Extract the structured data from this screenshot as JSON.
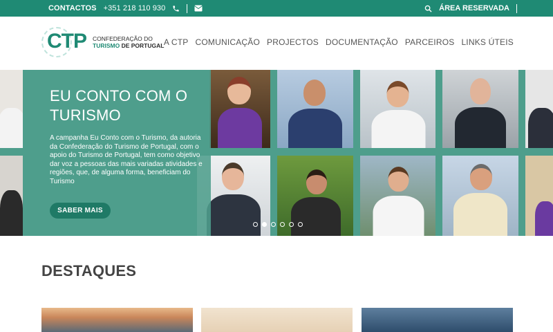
{
  "topbar": {
    "contact_label": "CONTACTOS",
    "phone": "+351 218 110 930",
    "icons": [
      "phone-icon",
      "mail-icon",
      "search-icon"
    ],
    "reserved_label": "ÁREA RESERVADA"
  },
  "logo": {
    "acronym": "CTP",
    "line1": "CONFEDERAÇÃO DO",
    "line2a": "TURISMO",
    "line2b": "DE PORTUGAL"
  },
  "nav": {
    "items": [
      "A CTP",
      "COMUNICAÇÃO",
      "PROJECTOS",
      "DOCUMENTAÇÃO",
      "PARCEIROS",
      "LINKS ÚTEIS"
    ]
  },
  "hero": {
    "title": "EU CONTO COM O TURISMO",
    "text": "A campanha Eu Conto com o Turismo, da autoria da Confederação do Turismo de Portugal, com o apoio do Turismo de Portugal, tem como objetivo dar voz a pessoas das mais variadas atividades e regiões, que, de alguma forma, beneficiam do Turismo",
    "button": "SABER MAIS",
    "slide_count": 6,
    "active_slide": 1,
    "colors": {
      "accent": "#1f8a74",
      "overlay": "#4e9e8c",
      "button": "#1f7a66"
    }
  },
  "destaques": {
    "title": "DESTAQUES"
  }
}
